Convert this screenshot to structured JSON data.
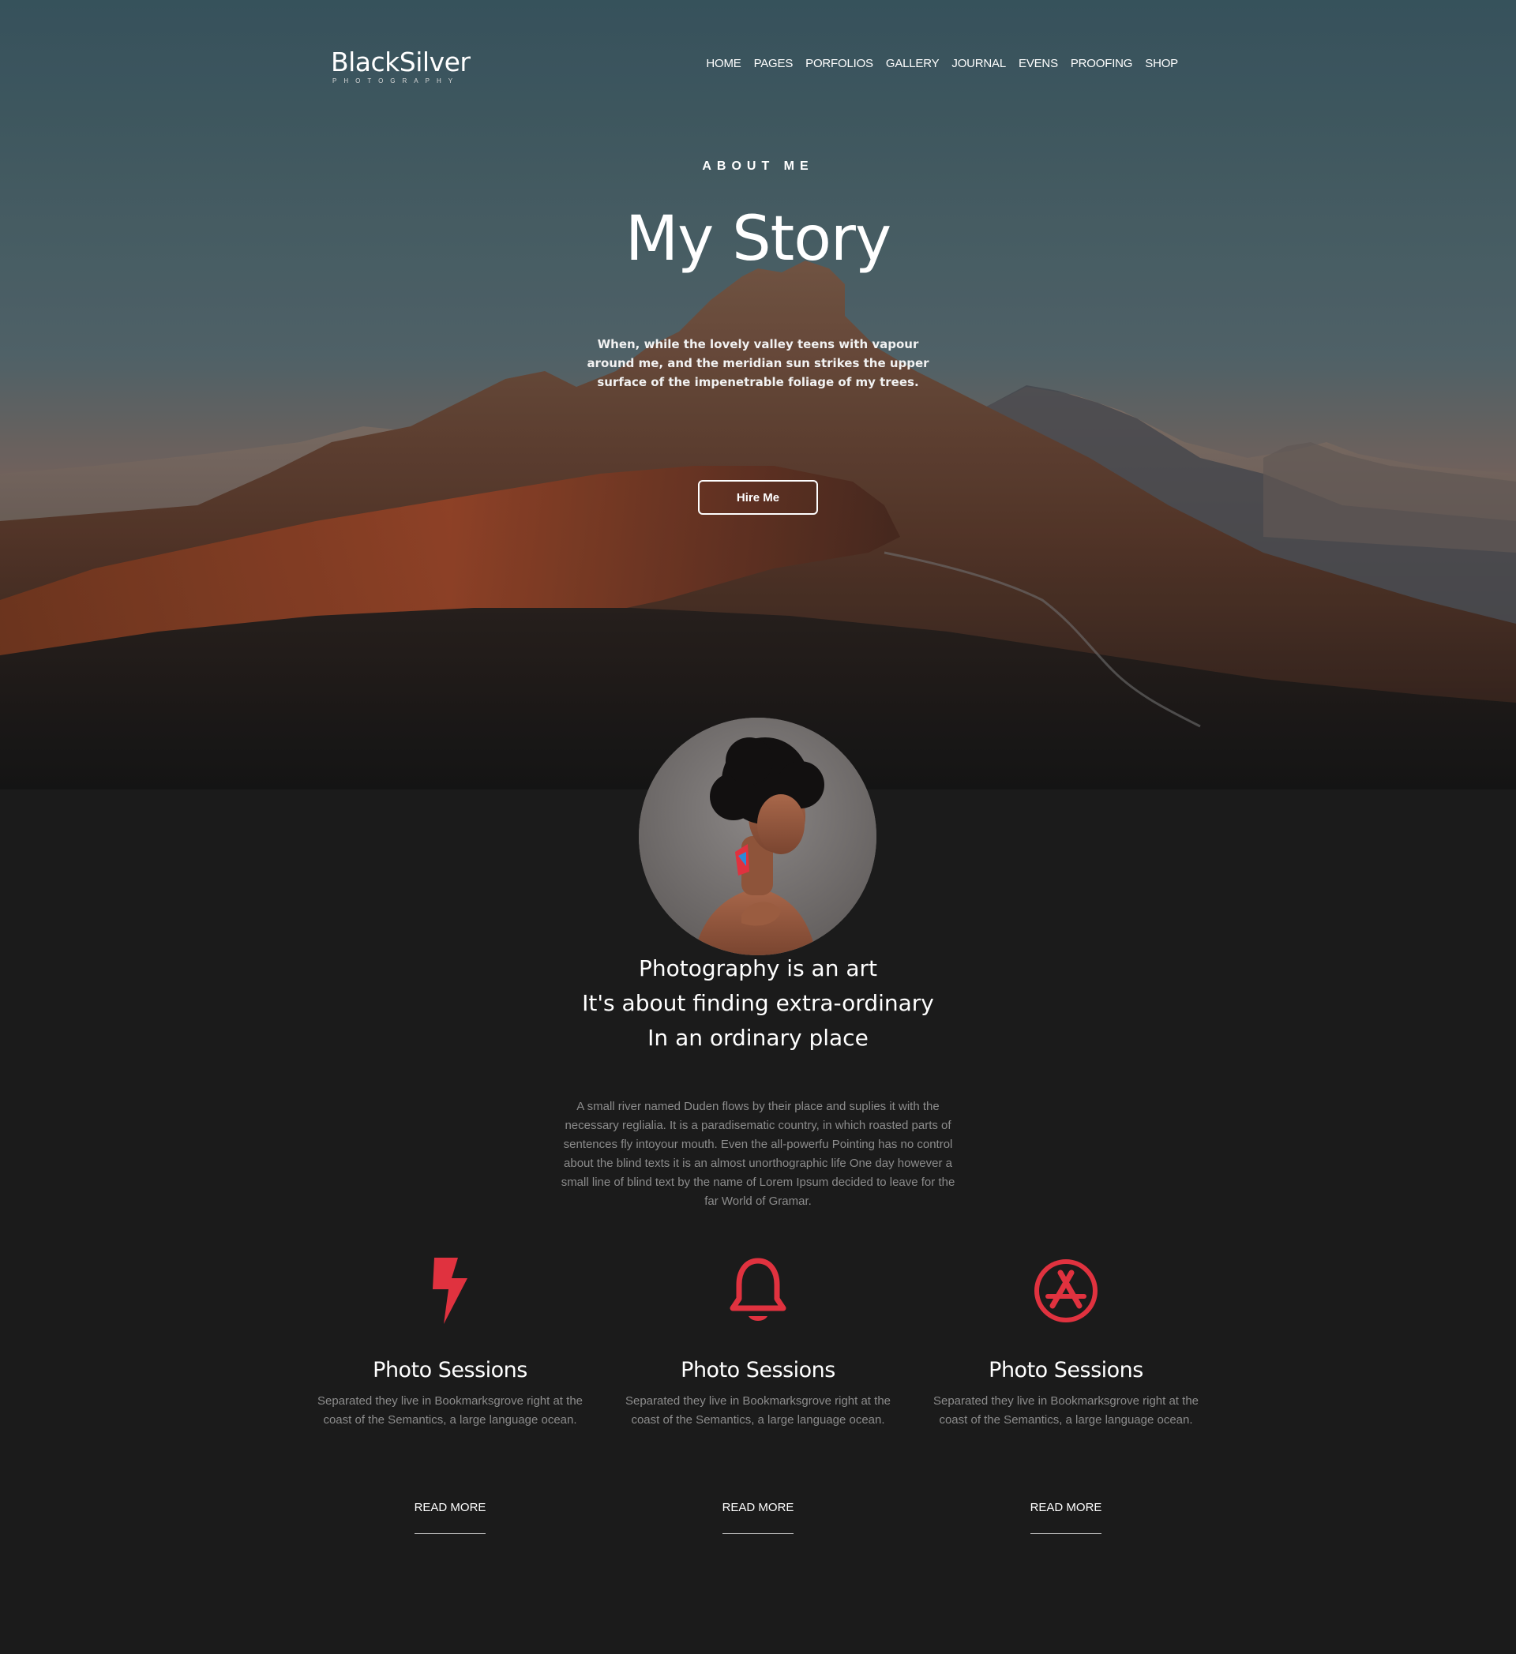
{
  "brand": {
    "name": "BlackSilver",
    "tagline": "PHOTOGRAPHY"
  },
  "nav": [
    "HOME",
    "PAGES",
    "PORFOLIOS",
    "GALLERY",
    "JOURNAL",
    "EVENS",
    "PROOFING",
    "SHOP"
  ],
  "hero": {
    "eyebrow": "ABOUT ME",
    "title": "My Story",
    "text": "When, while the lovely valley teens with vapour around me, and the meridian sun strikes the upper surface of the impenetrable foliage of my trees.",
    "button": "Hire Me"
  },
  "profile": {
    "tagline": [
      "Photography is an art",
      "It's about finding extra-ordinary",
      "In an ordinary place"
    ],
    "text": "A small river named Duden flows by their place and suplies it with the necessary reglialia. It is a paradisematic country, in which roasted parts of sentences fly intoyour mouth. Even the all-powerfu Pointing has no control about the blind texts it is an almost unorthographic life One day however a small line of blind text by the name of Lorem Ipsum decided to leave for the far World of Gramar."
  },
  "services": [
    {
      "icon": "lightning-icon",
      "title": "Photo Sessions",
      "text": "Separated they live in Bookmarksgrove right at the coast of the Semantics, a large language ocean.",
      "link": "READ MORE"
    },
    {
      "icon": "bell-icon",
      "title": "Photo Sessions",
      "text": "Separated they live in Bookmarksgrove right at the coast of the Semantics, a large language ocean.",
      "link": "READ MORE"
    },
    {
      "icon": "app-store-icon",
      "title": "Photo Sessions",
      "text": "Separated they live in Bookmarksgrove right at the coast of the Semantics, a large language ocean.",
      "link": "READ MORE"
    }
  ],
  "colors": {
    "accent": "#e0323f",
    "background": "#1b1b1b",
    "muted_text": "#8c8c8c"
  }
}
